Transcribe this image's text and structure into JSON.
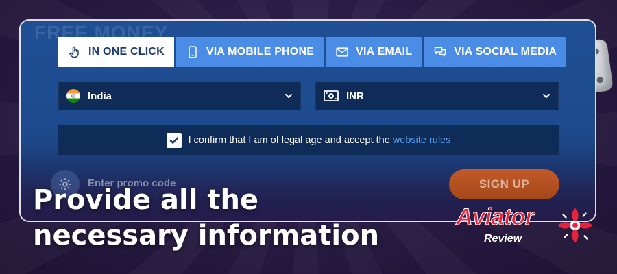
{
  "background_text": "FREE MONEY",
  "tabs": [
    {
      "label": "IN ONE CLICK",
      "icon": "pointer-hand-icon",
      "active": true
    },
    {
      "label": "VIA MOBILE PHONE",
      "icon": "mobile-phone-icon",
      "active": false
    },
    {
      "label": "VIA EMAIL",
      "icon": "envelope-icon",
      "active": false
    },
    {
      "label": "VIA SOCIAL MEDIA",
      "icon": "chat-bubbles-icon",
      "active": false
    }
  ],
  "country_select": {
    "value": "India",
    "icon": "india-flag-icon"
  },
  "currency_select": {
    "value": "INR",
    "icon": "banknote-icon"
  },
  "confirm": {
    "checked": true,
    "text": "I confirm that I am of legal age and accept the",
    "link_text": "website rules"
  },
  "promo": {
    "placeholder": "Enter promo code",
    "icon": "gear-icon"
  },
  "signup_label": "SIGN UP",
  "headline": {
    "line1": "Provide all the",
    "line2": "necessary information"
  },
  "logo": {
    "word": "Aviator",
    "sub": "Review"
  },
  "colors": {
    "tab_active_bg": "#ffffff",
    "tab_bg": "#4a8ce6",
    "field_bg": "#0f2b57",
    "link": "#5aa0f2",
    "signup": "#c35a2a",
    "logo_red": "#e8243c"
  }
}
